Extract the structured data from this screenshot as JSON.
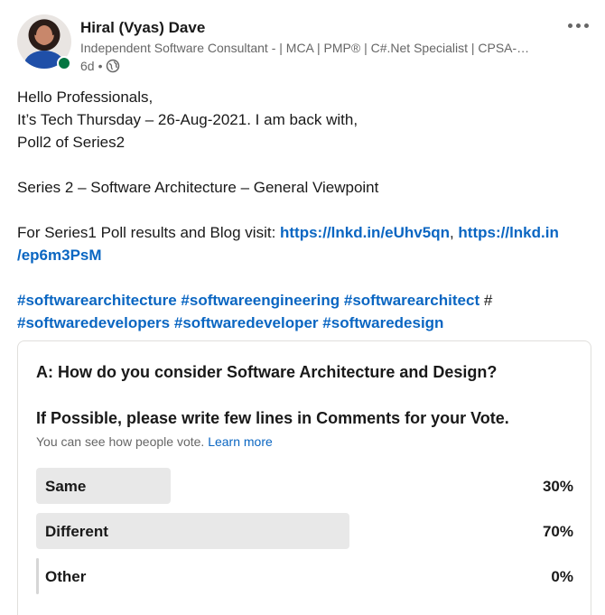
{
  "author": {
    "name": "Hiral (Vyas) Dave",
    "headline": "Independent Software Consultant - | MCA | PMP® | C#.Net Specialist | CPSA-…",
    "time": "6d",
    "separator": "•",
    "visibility_icon": "globe-icon",
    "presence_color": "#057642"
  },
  "menu_icon": "more-options-icon",
  "post": {
    "line1": "Hello Professionals,",
    "line2": "It’s Tech Thursday – 26-Aug-2021. I am back with,",
    "line3": "Poll2 of Series2",
    "line4": "Series 2 – Software Architecture – General Viewpoint",
    "line5_text": "For Series1 Poll results and Blog visit: ",
    "link1": "https://lnkd.in/eUhv5qn",
    "link_sep": ", ",
    "link2_part1": "https://lnkd.in",
    "link2_part2": "/ep6m3PsM",
    "hashtags_row1": [
      "#softwarearchitecture",
      "#softwareengineering",
      "#softwarearchitect"
    ],
    "hashtag_trailing": " #",
    "hashtags_row2": [
      "#softwaredevelopers",
      "#softwaredeveloper",
      "#softwaredesign"
    ],
    "link_color": "#0a66c2"
  },
  "poll": {
    "question1": "A: How do you consider Software Architecture and Design?",
    "question2": "If Possible, please write few lines in Comments for your Vote.",
    "note": "You can see how people vote.",
    "learn_more": "Learn more",
    "options": [
      {
        "label": "Same",
        "percent_text": "30%",
        "fraction": 0.3
      },
      {
        "label": "Different",
        "percent_text": "70%",
        "fraction": 0.7
      },
      {
        "label": "Other",
        "percent_text": "0%",
        "fraction": 0.0
      }
    ]
  }
}
